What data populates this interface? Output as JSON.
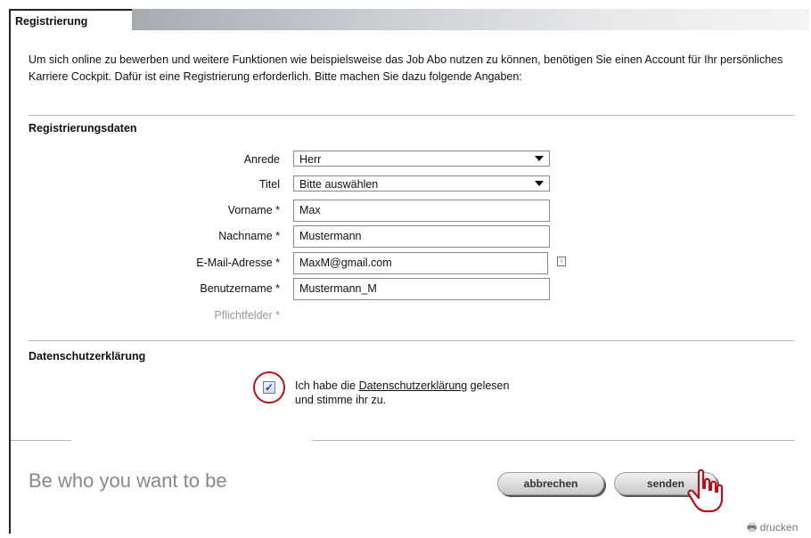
{
  "tab": {
    "title": "Registrierung"
  },
  "intro": "Um sich online zu bewerben und weitere Funktionen wie beispielsweise das Job Abo nutzen zu können, benötigen Sie einen Account für Ihr persönliches Karriere Cockpit. Dafür ist eine Registrierung erforderlich. Bitte machen Sie dazu folgende Angaben:",
  "form": {
    "section_title": "Registrierungsdaten",
    "anrede": {
      "label": "Anrede",
      "value": "Herr"
    },
    "titel": {
      "label": "Titel",
      "value": "Bitte auswählen"
    },
    "vorname": {
      "label": "Vorname *",
      "value": "Max"
    },
    "nachname": {
      "label": "Nachname *",
      "value": "Mustermann"
    },
    "email": {
      "label": "E-Mail-Adresse *",
      "value": "MaxM@gmail.com"
    },
    "benutzername": {
      "label": "Benutzername *",
      "value": "Mustermann_M"
    },
    "pflicht": "Pflichtfelder *"
  },
  "privacy": {
    "section_title": "Datenschutzerklärung",
    "checked": true,
    "text_before": "Ich habe die ",
    "link": "Datenschutzerklärung",
    "text_after": " gelesen",
    "text_line2": "und stimme ihr zu."
  },
  "footer": {
    "slogan": "Be who you want to be",
    "cancel_label": "abbrechen",
    "send_label": "senden",
    "print_label": "drucken"
  },
  "icons": {
    "checkbox": "checkmark-icon",
    "info": "info-icon",
    "cursor": "hand-pointer-icon",
    "print": "printer-icon"
  },
  "colors": {
    "highlight_ring": "#b5121b"
  }
}
